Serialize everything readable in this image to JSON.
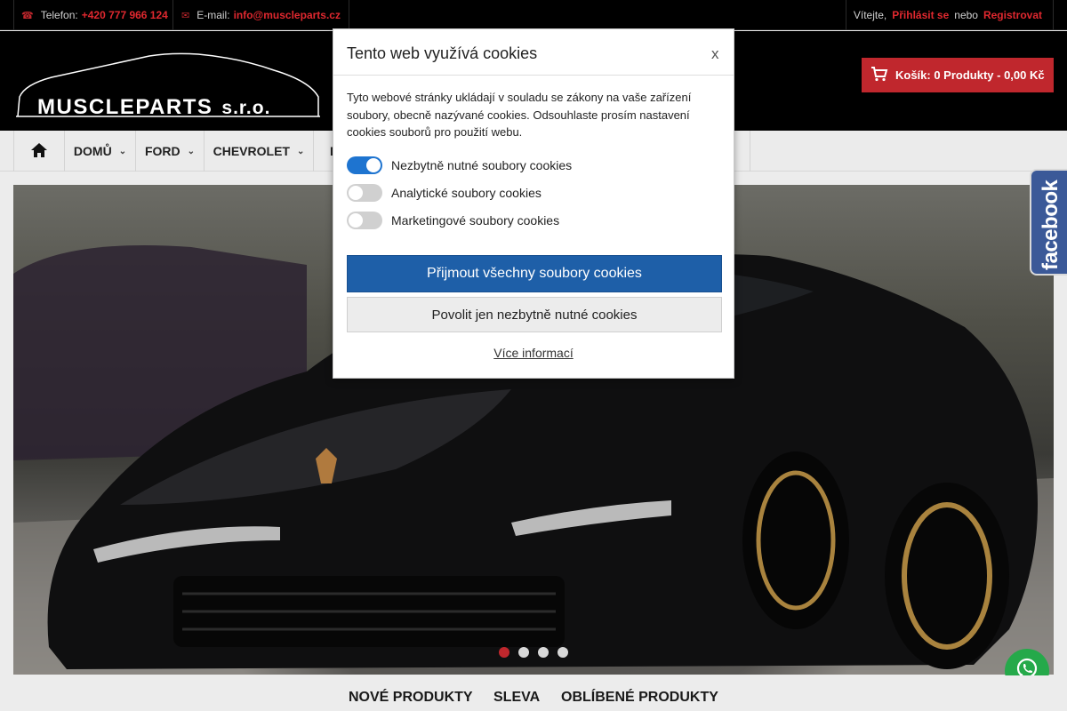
{
  "topbar": {
    "phone_label": "Telefon:",
    "phone_value": "+420 777 966 124",
    "email_label": "E-mail:",
    "email_value": "info@muscleparts.cz",
    "welcome": "Vítejte,",
    "login": "Přihlásit se",
    "or": "nebo",
    "register": "Registrovat",
    "phone_icon": "phone-icon",
    "email_icon": "envelope-icon"
  },
  "header": {
    "logo_text": "MUSCLEPARTS",
    "logo_suffix": "s.r.o.",
    "cart_label": "Košík: 0 Produkty - 0,00 Kč",
    "cart_icon": "cart-icon"
  },
  "nav": {
    "home_icon": "home-icon",
    "items": [
      {
        "label": "DOMŮ"
      },
      {
        "label": "FORD"
      },
      {
        "label": "CHEVROLET"
      },
      {
        "label": "D"
      }
    ]
  },
  "hero": {
    "slide_count": 4,
    "active_slide": 1
  },
  "social": {
    "facebook_label": "facebook",
    "whatsapp_icon": "whatsapp-icon"
  },
  "product_tabs": [
    {
      "label": "NOVÉ PRODUKTY"
    },
    {
      "label": "SLEVA"
    },
    {
      "label": "OBLÍBENÉ PRODUKTY"
    }
  ],
  "cookie_modal": {
    "title": "Tento web využívá cookies",
    "close": "x",
    "description": "Tyto webové stránky ukládají v souladu se zákony na vaše zařízení soubory, obecně nazývané cookies. Odsouhlaste prosím nastavení cookies souborů pro použití webu.",
    "options": [
      {
        "label": "Nezbytně nutné soubory cookies",
        "enabled": true
      },
      {
        "label": "Analytické soubory cookies",
        "enabled": false
      },
      {
        "label": "Marketingové soubory cookies",
        "enabled": false
      }
    ],
    "accept_all": "Přijmout všechny soubory cookies",
    "allow_essential": "Povolit jen nezbytně nutné cookies",
    "more_info": "Více informací"
  },
  "colors": {
    "accent_red": "#c0272d",
    "accept_blue": "#1e5fa8",
    "toggle_on": "#1e74d0",
    "facebook_blue": "#3b5998",
    "whatsapp_green": "#25a94a"
  }
}
